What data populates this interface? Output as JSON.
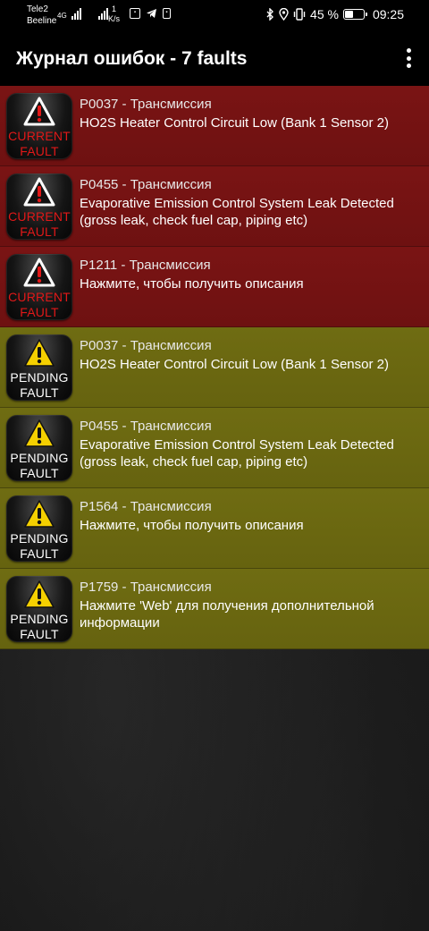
{
  "status_bar": {
    "carrier1": "Tele2",
    "carrier2": "Beeline",
    "net_type": "4G",
    "speed_value": "1",
    "speed_unit": "K/s",
    "battery_percent": "45 %",
    "battery_level": 0.45,
    "time": "09:25",
    "icons": [
      "obd-app-icon",
      "telegram-icon",
      "sim-app-icon",
      "bluetooth-icon",
      "location-icon",
      "vibrate-icon"
    ]
  },
  "app_bar": {
    "title": "Журнал ошибок - 7 faults",
    "menu_icon": "overflow-menu-icon"
  },
  "faults": [
    {
      "type": "current",
      "badge_line1": "CURRENT",
      "badge_line2": "FAULT",
      "code": "P0037 - Трансмиссия",
      "description": "HO2S Heater Control Circuit Low (Bank 1 Sensor 2)"
    },
    {
      "type": "current",
      "badge_line1": "CURRENT",
      "badge_line2": "FAULT",
      "code": "P0455 - Трансмиссия",
      "description": "Evaporative Emission Control System Leak Detected (gross leak, check fuel cap, piping etc)"
    },
    {
      "type": "current",
      "badge_line1": "CURRENT",
      "badge_line2": "FAULT",
      "code": "P1211 - Трансмиссия",
      "description": "Нажмите, чтобы получить описания"
    },
    {
      "type": "pending",
      "badge_line1": "PENDING",
      "badge_line2": "FAULT",
      "code": "P0037 - Трансмиссия",
      "description": "HO2S Heater Control Circuit Low (Bank 1 Sensor 2)"
    },
    {
      "type": "pending",
      "badge_line1": "PENDING",
      "badge_line2": "FAULT",
      "code": "P0455 - Трансмиссия",
      "description": "Evaporative Emission Control System Leak Detected (gross leak, check fuel cap, piping etc)"
    },
    {
      "type": "pending",
      "badge_line1": "PENDING",
      "badge_line2": "FAULT",
      "code": "P1564 - Трансмиссия",
      "description": "Нажмите, чтобы получить описания"
    },
    {
      "type": "pending",
      "badge_line1": "PENDING",
      "badge_line2": "FAULT",
      "code": "P1759 - Трансмиссия",
      "description": "Нажмите 'Web' для получения дополнительной информации"
    }
  ],
  "colors": {
    "current_row": "#7a1414",
    "pending_row": "#6f6c12",
    "current_badge_text": "#e01818",
    "warning_current": "#ffffff",
    "warning_pending": "#f5d000"
  }
}
